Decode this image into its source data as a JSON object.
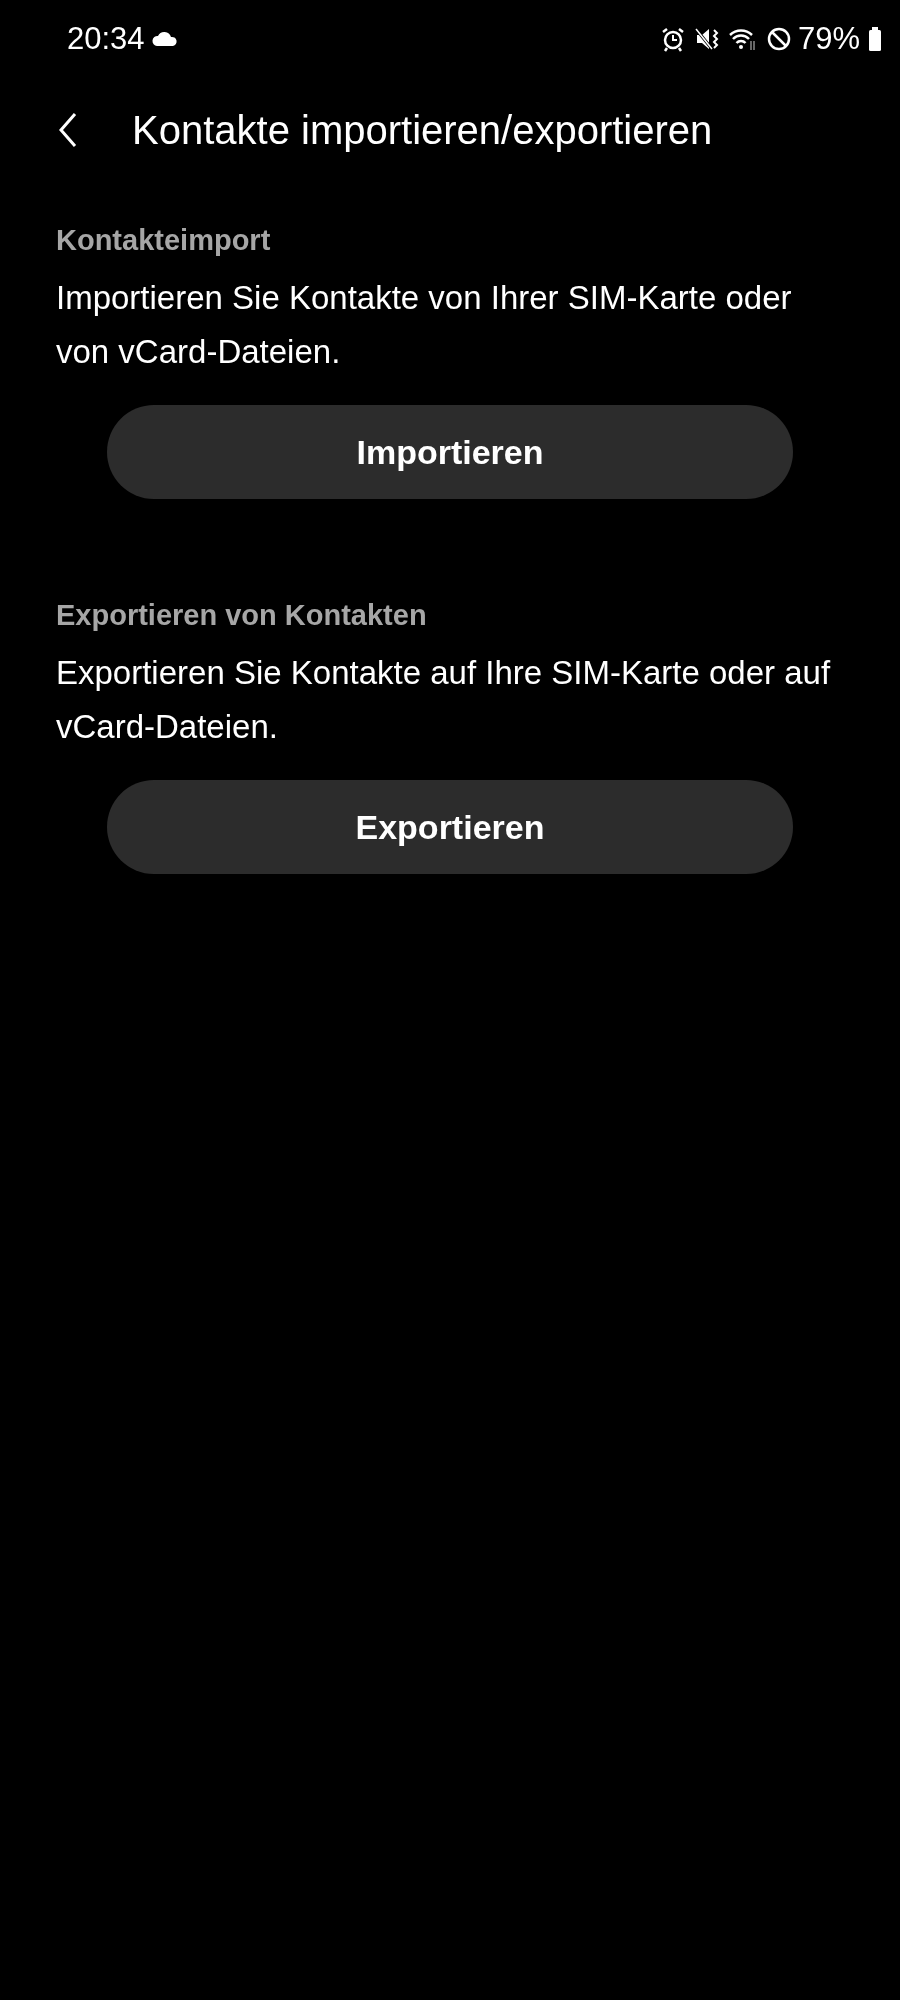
{
  "status_bar": {
    "time": "20:34",
    "battery": "79%"
  },
  "header": {
    "title": "Kontakte importieren/exportieren"
  },
  "sections": [
    {
      "label": "Kontakteimport",
      "description": "Importieren Sie Kontakte von Ihrer SIM-Karte oder von vCard-Dateien.",
      "button": "Importieren"
    },
    {
      "label": "Exportieren von Kontakten",
      "description": "Exportieren Sie Kontakte auf Ihre SIM-Karte oder auf vCard-Dateien.",
      "button": "Exportieren"
    }
  ]
}
